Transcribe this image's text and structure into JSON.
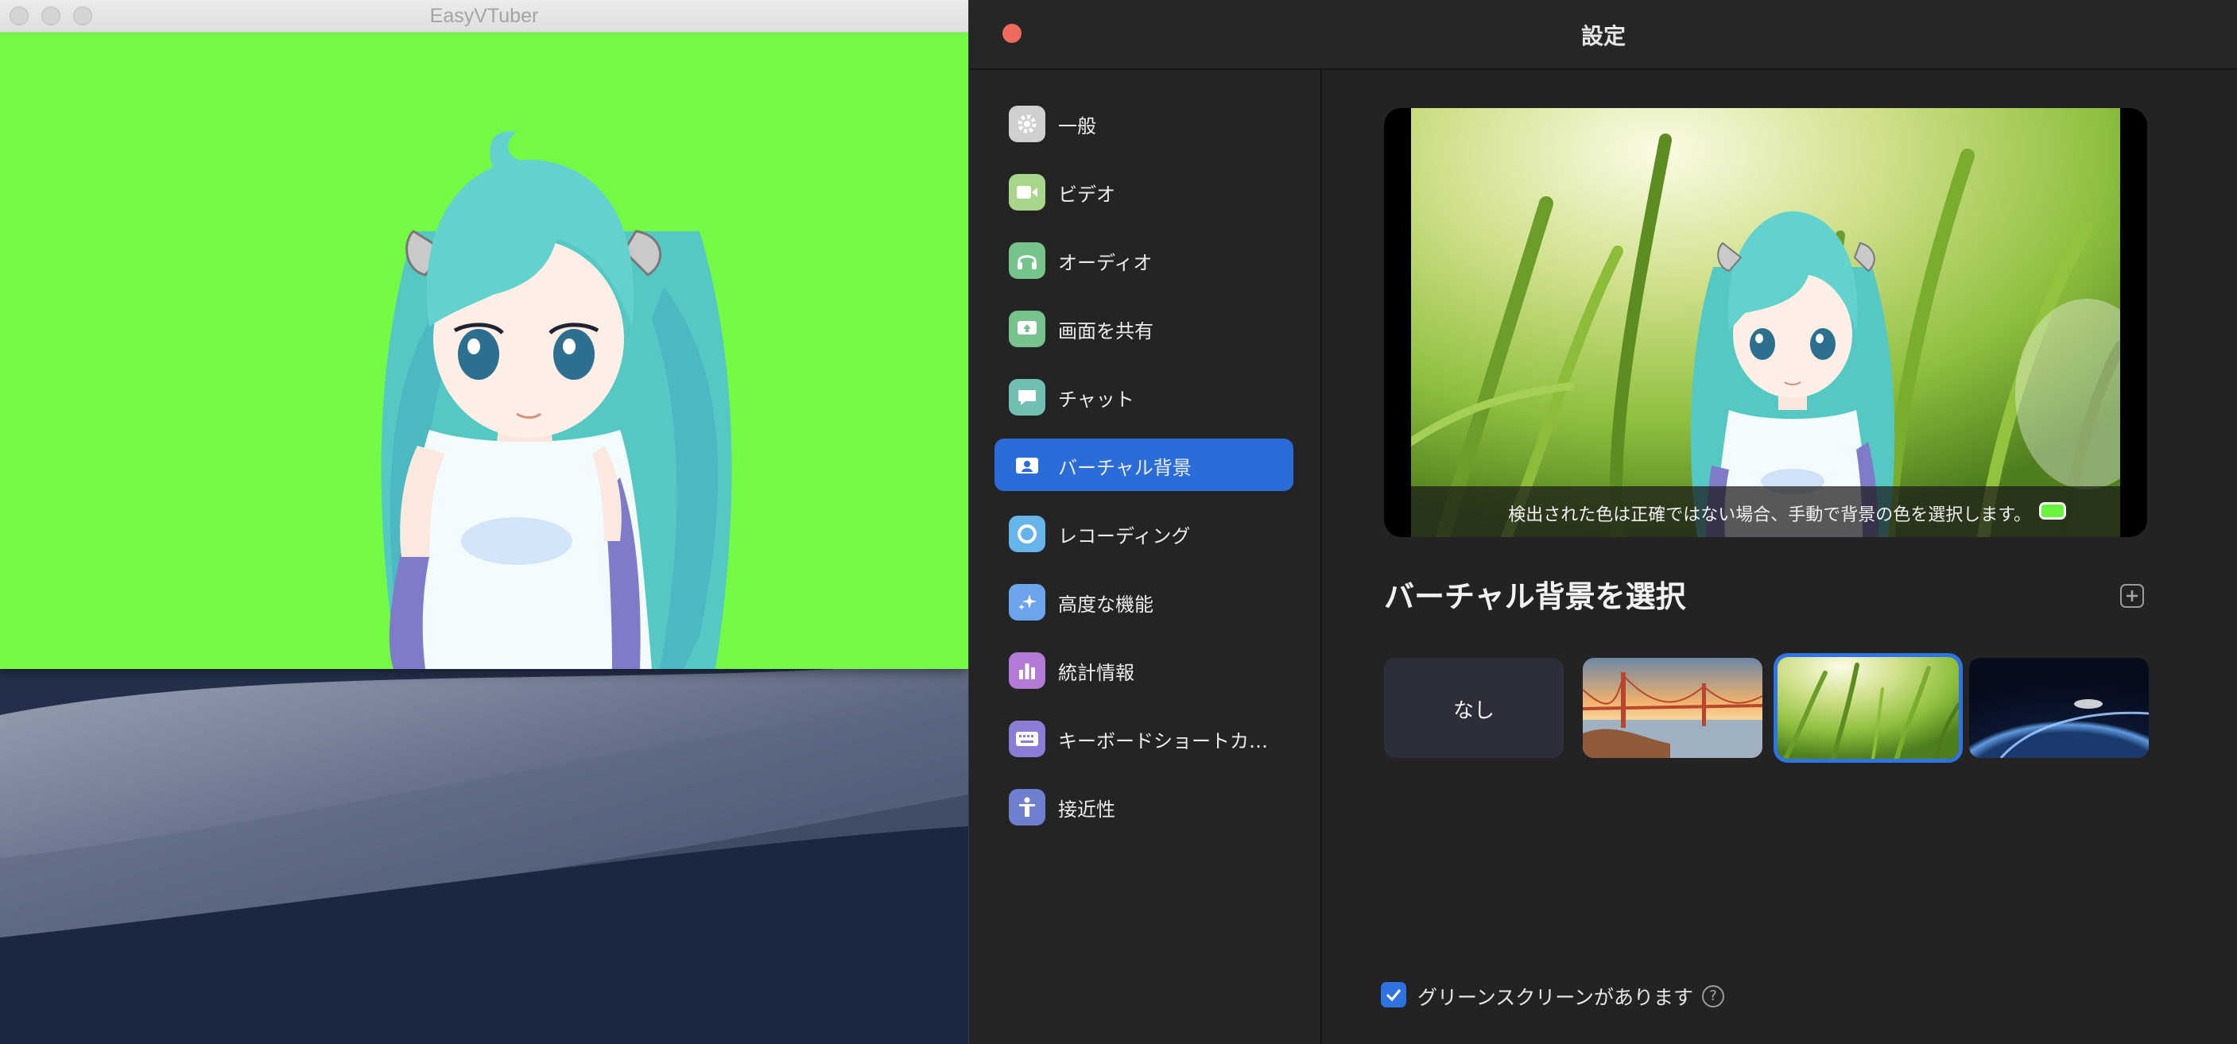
{
  "vtuber_window": {
    "title": "EasyVTuber",
    "background_color": "#74fa45"
  },
  "settings": {
    "title": "設定",
    "sidebar": {
      "items": [
        {
          "label": "一般",
          "icon": "gear-icon",
          "color": "#d0d0d0",
          "active": false
        },
        {
          "label": "ビデオ",
          "icon": "video-camera-icon",
          "color": "#a7d58a",
          "active": false
        },
        {
          "label": "オーディオ",
          "icon": "headphones-icon",
          "color": "#76c48b",
          "active": false
        },
        {
          "label": "画面を共有",
          "icon": "share-screen-icon",
          "color": "#78c28e",
          "active": false
        },
        {
          "label": "チャット",
          "icon": "chat-bubble-icon",
          "color": "#6fbfb2",
          "active": false
        },
        {
          "label": "バーチャル背景",
          "icon": "virtual-background-icon",
          "color": "#2a6cd8",
          "active": true
        },
        {
          "label": "レコーディング",
          "icon": "record-icon",
          "color": "#65b4ea",
          "active": false
        },
        {
          "label": "高度な機能",
          "icon": "sparkle-icon",
          "color": "#6ea4ec",
          "active": false
        },
        {
          "label": "統計情報",
          "icon": "bar-chart-icon",
          "color": "#b27ad6",
          "active": false
        },
        {
          "label": "キーボードショートカ…",
          "icon": "keyboard-icon",
          "color": "#8a7dd6",
          "active": false
        },
        {
          "label": "接近性",
          "icon": "accessibility-icon",
          "color": "#6f7fd0",
          "active": false
        }
      ]
    },
    "virtual_background": {
      "preview_hint": "検出された色は正確ではない場合、手動で背景の色を選択します。",
      "detected_color": "#6bf23e",
      "heading": "バーチャル背景を選択",
      "backgrounds": [
        {
          "label": "なし",
          "selected": false
        },
        {
          "label": "",
          "image": "golden-gate-bridge",
          "selected": false
        },
        {
          "label": "",
          "image": "grass",
          "selected": true
        },
        {
          "label": "",
          "image": "earth-from-space",
          "selected": false
        }
      ],
      "green_screen_label": "グリーンスクリーンがあります",
      "green_screen_checked": true,
      "accent_color": "#2f73e2"
    }
  }
}
